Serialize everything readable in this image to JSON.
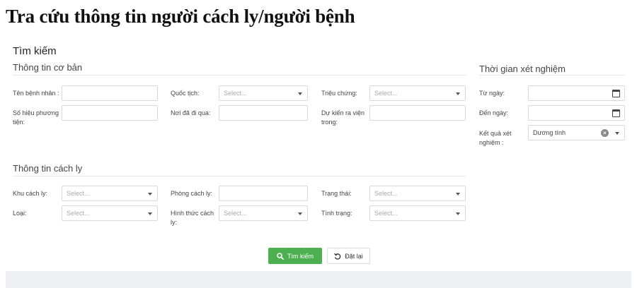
{
  "page": {
    "title": "Tra cứu thông tin người cách ly/người bệnh"
  },
  "search": {
    "heading": "Tìm kiếm",
    "basic": {
      "title": "Thông tin cơ bản",
      "patient_name_label": "Tên bệnh nhân :",
      "nationality_label": "Quốc tịch:",
      "nationality_placeholder": "Select...",
      "symptoms_label": "Triệu chứng:",
      "symptoms_placeholder": "Select...",
      "vehicle_label": "Số hiệu phương tiện:",
      "visited_label": "Nơi đã đi qua:",
      "discharge_label": "Dự kiến ra viện trong:"
    },
    "test_time": {
      "title": "Thời gian xét nghiệm",
      "from_label": "Từ ngày:",
      "to_label": "Đến ngày:",
      "result_label": "Kết quả xét nghiệm :",
      "result_value": "Dương tính"
    },
    "quarantine": {
      "title": "Thông tin cách ly",
      "area_label": "Khu cách ly:",
      "area_placeholder": "Select...",
      "room_label": "Phòng cách ly:",
      "status_label": "Trạng thái:",
      "status_placeholder": "Select...",
      "type_label": "Loại:",
      "type_placeholder": "Select...",
      "form_label": "Hình thức cách ly:",
      "form_placeholder": "Select...",
      "condition_label": "Tình trạng:",
      "condition_placeholder": "Select..."
    },
    "buttons": {
      "search_label": "Tìm kiếm",
      "reset_label": "Đặt lại"
    }
  },
  "colors": {
    "primary": "#4caf50",
    "border": "#d9d9d9"
  }
}
